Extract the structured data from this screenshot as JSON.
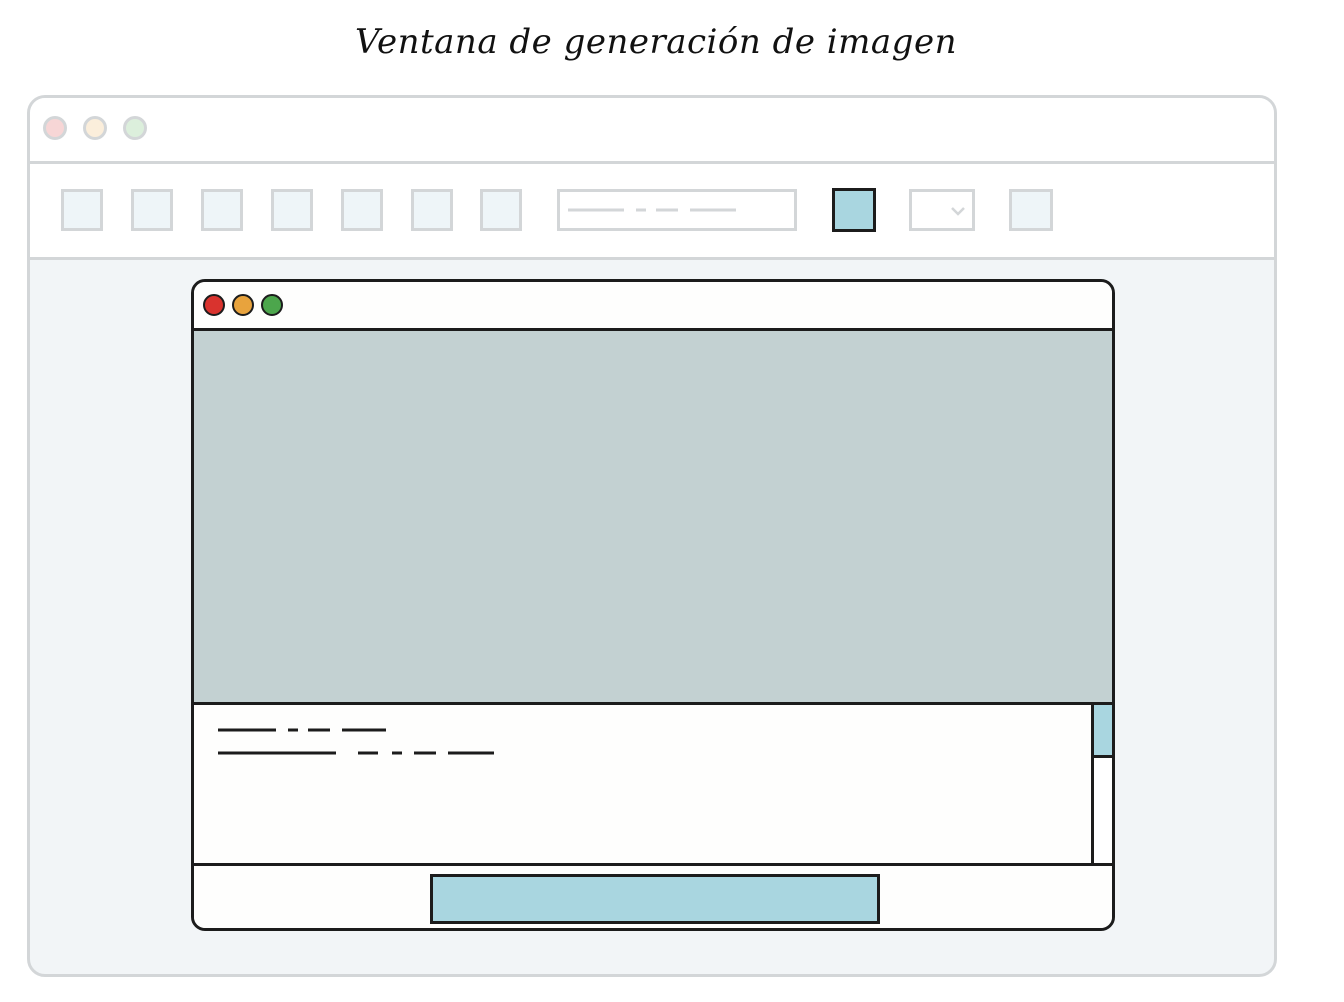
{
  "page": {
    "title": "Ventana de generación de imagen"
  },
  "colors": {
    "accent": "#a9d6e0",
    "preview": "#c3d1d2",
    "outline": "#1c1c1c",
    "faded_outline": "#d3d6d8",
    "faded_bg": "#f2f5f7",
    "close_dot": "#d9332e",
    "minimize_dot": "#e8a33d",
    "maximize_dot": "#4ca64c",
    "faded_close_dot": "#f7d6d6",
    "faded_minimize_dot": "#fbeedb",
    "faded_maximize_dot": "#dcefdc"
  },
  "icons": {
    "select_chevron": "chevron-down-icon"
  }
}
